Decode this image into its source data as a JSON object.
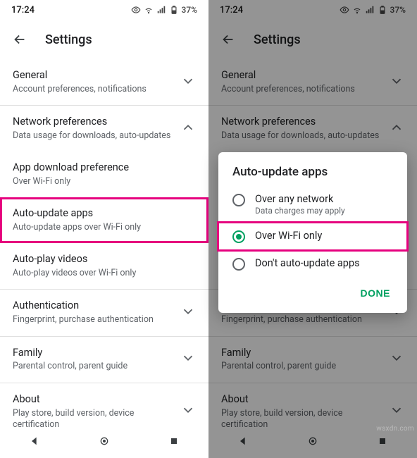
{
  "status": {
    "time": "17:24",
    "battery": "37%"
  },
  "appbar": {
    "title": "Settings"
  },
  "sections": {
    "general": {
      "label": "General",
      "sub": "Account preferences, notifications"
    },
    "network": {
      "label": "Network preferences",
      "sub": "Data usage for downloads, auto-updates"
    },
    "download": {
      "label": "App download preference",
      "sub": "Over Wi-Fi only"
    },
    "autoupdate": {
      "label": "Auto-update apps",
      "sub": "Auto-update apps over Wi-Fi only"
    },
    "autoplay": {
      "label": "Auto-play videos",
      "sub": "Auto-play videos over Wi-Fi only"
    },
    "auth": {
      "label": "Authentication",
      "sub": "Fingerprint, purchase authentication"
    },
    "family": {
      "label": "Family",
      "sub": "Parental control, parent guide"
    },
    "about": {
      "label": "About",
      "sub": "Play store, build version, device certification"
    }
  },
  "dialog": {
    "title": "Auto-update apps",
    "opt1": {
      "label": "Over any network",
      "sub": "Data charges may apply"
    },
    "opt2": {
      "label": "Over Wi-Fi only"
    },
    "opt3": {
      "label": "Don't auto-update apps"
    },
    "done": "DONE"
  },
  "watermark": "wsxdn.com"
}
